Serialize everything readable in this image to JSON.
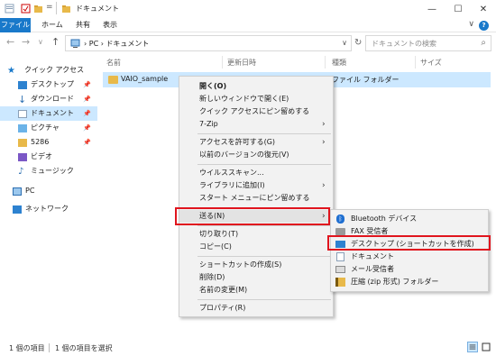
{
  "window": {
    "title": "ドキュメント",
    "qa_toolbar_arrow": "=",
    "min": "—",
    "max": "☐",
    "close": "✕"
  },
  "ribbon": {
    "file": "ファイル",
    "tabs": [
      "ホーム",
      "共有",
      "表示"
    ],
    "help": "?",
    "expand": "∨"
  },
  "nav": {
    "back": "←",
    "forward": "→",
    "recent": "∨",
    "up": "↑"
  },
  "address": {
    "path": "›  PC  ›  ドキュメント",
    "dropdown": "∨"
  },
  "search": {
    "placeholder": "ドキュメントの検索"
  },
  "sidebar": {
    "items": [
      {
        "label": "クイック アクセス",
        "icon": "star-icon",
        "pinned": false
      },
      {
        "label": "デスクトップ",
        "icon": "desktop-icon",
        "pinned": true
      },
      {
        "label": "ダウンロード",
        "icon": "download-icon",
        "pinned": true
      },
      {
        "label": "ドキュメント",
        "icon": "document-icon",
        "pinned": true,
        "selected": true
      },
      {
        "label": "ピクチャ",
        "icon": "pictures-icon",
        "pinned": true
      },
      {
        "label": "5286",
        "icon": "folder-icon",
        "pinned": true
      },
      {
        "label": "ビデオ",
        "icon": "video-icon",
        "pinned": false
      },
      {
        "label": "ミュージック",
        "icon": "music-icon",
        "pinned": false
      },
      {
        "label": "PC",
        "icon": "pc-icon",
        "pinned": false
      },
      {
        "label": "ネットワーク",
        "icon": "network-icon",
        "pinned": false
      }
    ]
  },
  "columns": [
    "名前",
    "更新日時",
    "種類",
    "サイズ"
  ],
  "files": [
    {
      "name": "VAIO_sample",
      "type": "ファイル フォルダー"
    }
  ],
  "context_menu": [
    {
      "label": "開く(O)",
      "bold": true
    },
    {
      "label": "新しいウィンドウで開く(E)"
    },
    {
      "label": "クイック アクセスにピン留めする"
    },
    {
      "label": "7-Zip",
      "submenu": true
    },
    {
      "label": "アクセスを許可する(G)",
      "submenu": true
    },
    {
      "label": "以前のバージョンの復元(V)"
    },
    {
      "label": "ウイルススキャン..."
    },
    {
      "label": "ライブラリに追加(I)",
      "submenu": true
    },
    {
      "label": "スタート メニューにピン留めする"
    },
    {
      "label": "送る(N)",
      "submenu": true
    },
    {
      "label": "切り取り(T)"
    },
    {
      "label": "コピー(C)"
    },
    {
      "label": "ショートカットの作成(S)"
    },
    {
      "label": "削除(D)"
    },
    {
      "label": "名前の変更(M)"
    },
    {
      "label": "プロパティ(R)"
    }
  ],
  "sendto_menu": [
    {
      "label": "Bluetooth デバイス",
      "icon": "bluetooth-icon"
    },
    {
      "label": "FAX 受信者",
      "icon": "fax-icon"
    },
    {
      "label": "デスクトップ (ショートカットを作成)",
      "icon": "desktop-icon"
    },
    {
      "label": "ドキュメント",
      "icon": "document-icon"
    },
    {
      "label": "メール受信者",
      "icon": "mail-icon"
    },
    {
      "label": "圧縮 (zip 形式) フォルダー",
      "icon": "zip-icon"
    }
  ],
  "status": {
    "count": "1 個の項目",
    "selected": "1 個の項目を選択"
  },
  "colors": {
    "accent": "#1979ca",
    "selection": "#cce8ff",
    "highlight": "#e0151e"
  }
}
